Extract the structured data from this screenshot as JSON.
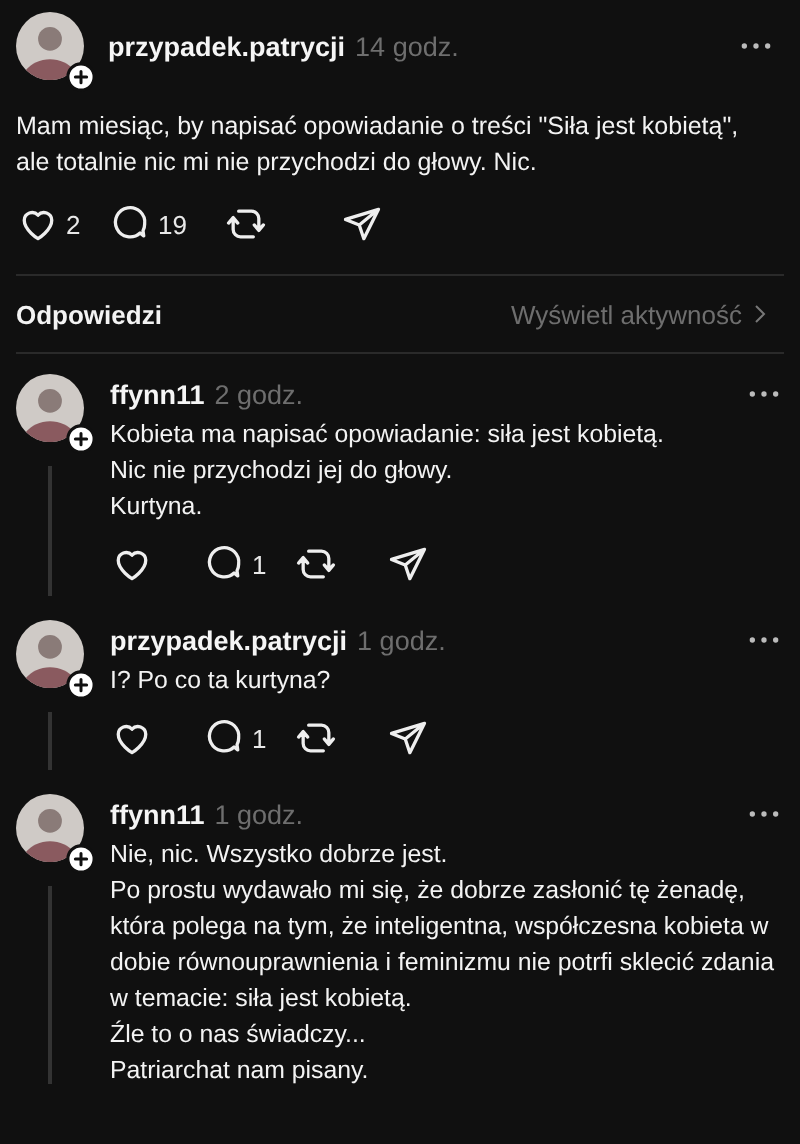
{
  "post": {
    "author": "przypadek.patrycji",
    "time": "14 godz.",
    "text": "Mam miesiąc, by napisać opowiadanie o treści \"Siła jest kobietą\", ale totalnie nic mi nie przychodzi do głowy. Nic.",
    "likes": "2",
    "replies": "19"
  },
  "replies_header": {
    "title": "Odpowiedzi",
    "link": "Wyświetl aktywność"
  },
  "replies": [
    {
      "author": "ffynn11",
      "time": "2 godz.",
      "text": "Kobieta ma napisać opowiadanie: siła jest kobietą.\nNic nie przychodzi jej do głowy.\nKurtyna.",
      "replies": "1",
      "thread_line": true,
      "actions": true
    },
    {
      "author": "przypadek.patrycji",
      "time": "1 godz.",
      "text": "I? Po co ta kurtyna?",
      "replies": "1",
      "thread_line": true,
      "actions": true
    },
    {
      "author": "ffynn11",
      "time": "1 godz.",
      "text": "Nie, nic. Wszystko dobrze jest.\nPo prostu wydawało mi się, że dobrze zasłonić tę żenadę, która polega na tym, że inteligentna, współczesna kobieta w dobie równouprawnienia i feminizmu nie potrfi sklecić zdania w temacie: siła jest kobietą.\nŹle to o nas świadczy...\nPatriarchat nam pisany.",
      "thread_line": true
    }
  ]
}
